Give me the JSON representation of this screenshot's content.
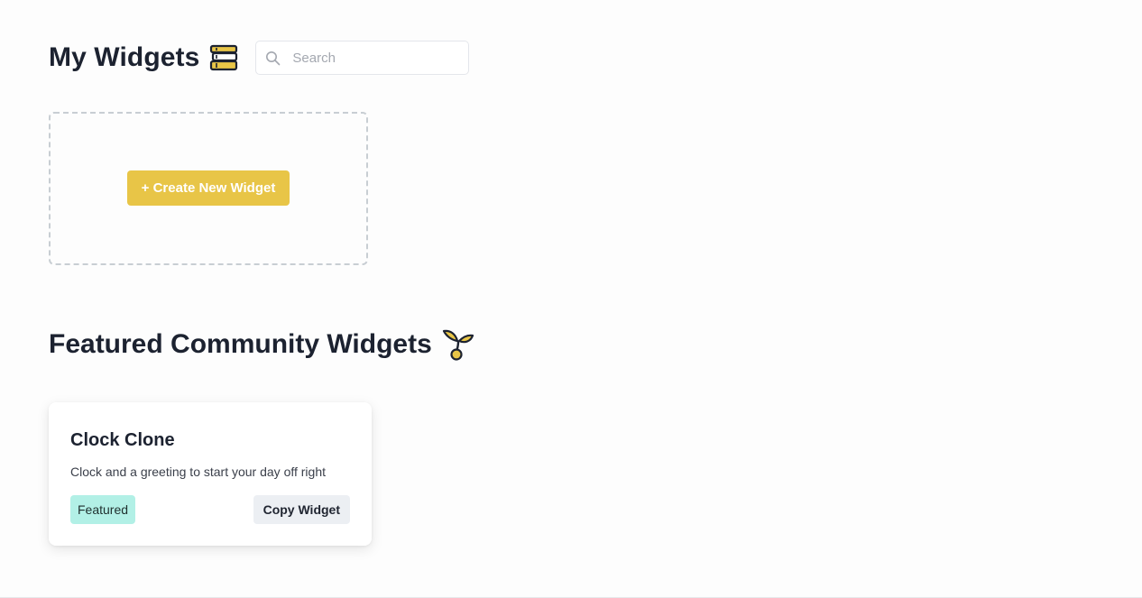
{
  "header": {
    "title": "My Widgets",
    "title_icon": "books-icon"
  },
  "search": {
    "placeholder": "Search",
    "value": ""
  },
  "create_card": {
    "button_label": "+ Create New Widget"
  },
  "featured": {
    "title": "Featured Community Widgets",
    "title_icon": "sprout-icon",
    "widgets": [
      {
        "title": "Clock Clone",
        "description": "Clock and a greeting to start your day off right",
        "badge": "Featured",
        "action_label": "Copy Widget"
      }
    ]
  },
  "colors": {
    "accent": "#e8c547",
    "badge_bg": "#b2f0e6",
    "button_secondary_bg": "#eceff3",
    "text_dark": "#1c2230"
  }
}
